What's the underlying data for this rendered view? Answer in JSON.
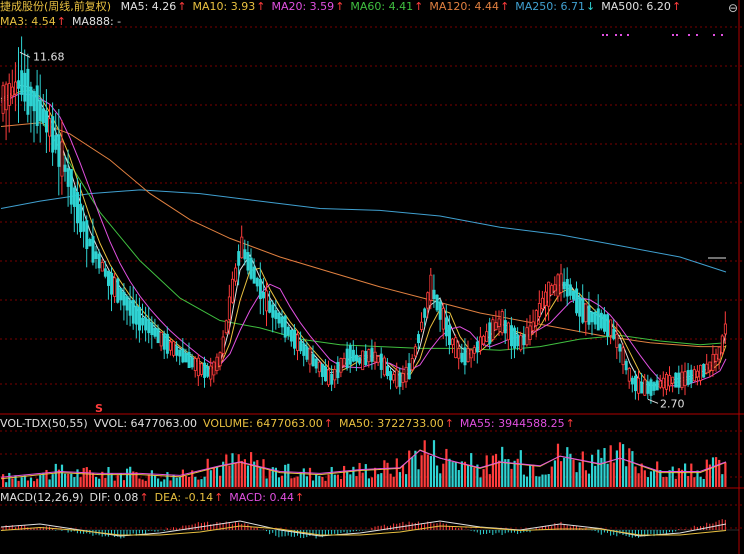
{
  "header": {
    "stock_title": "捷成股份(周线,前复权)",
    "ma_items": [
      {
        "text": "MA5: 4.26",
        "color": "#e0e0e0"
      },
      {
        "text": "MA10: 3.93",
        "color": "#e8c040"
      },
      {
        "text": "MA20: 3.59",
        "color": "#e050e0"
      },
      {
        "text": "MA60: 4.41",
        "color": "#40c040"
      },
      {
        "text": "MA120: 4.44",
        "color": "#e08040"
      },
      {
        "text": "MA250: 6.71",
        "color": "#40a0d0"
      },
      {
        "text": "MA500: 6.20",
        "color": "#e0e0e0"
      }
    ],
    "row2_items": [
      {
        "text": "MA3: 4.54",
        "color": "#e8c040"
      },
      {
        "text": "MA888: -",
        "color": "#e0e0e0"
      }
    ],
    "arrow_up": "↑",
    "arrow_down": "↓",
    "minimize_icon": "⊖"
  },
  "price_panel": {
    "high_label": "11.68",
    "low_label": "2.70",
    "marker": "S"
  },
  "volume_header": {
    "items": [
      {
        "text": "VOL-TDX(50,55)",
        "color": "#e0e0e0"
      },
      {
        "text": "VVOL: 6477063.00",
        "color": "#e0e0e0"
      },
      {
        "text": "VOLUME: 6477063.00",
        "color": "#e8c040"
      },
      {
        "text": "MA50: 3722733.00",
        "color": "#e8c040"
      },
      {
        "text": "MA55: 3944588.25",
        "color": "#e050e0"
      }
    ]
  },
  "macd_header": {
    "items": [
      {
        "text": "MACD(12,26,9)",
        "color": "#e0e0e0"
      },
      {
        "text": "DIF: 0.08",
        "color": "#e0e0e0"
      },
      {
        "text": "DEA: -0.14",
        "color": "#e8c040"
      },
      {
        "text": "MACD: 0.44",
        "color": "#e050e0"
      }
    ]
  },
  "colors": {
    "up": "#ff3c3c",
    "down": "#2fd3d3",
    "grid": "#7a0000",
    "ma5": "#e0e0e0",
    "ma10": "#e8c040",
    "ma20": "#e050e0",
    "ma60": "#40c040",
    "ma120": "#e08040",
    "ma250": "#40a0d0"
  },
  "chart_data": {
    "type": "candlestick",
    "price_range": [
      2.2,
      12.6
    ],
    "ma250_path": [
      [
        1,
        7.6
      ],
      [
        40,
        7.8
      ],
      [
        90,
        8.0
      ],
      [
        140,
        8.1
      ],
      [
        200,
        8.0
      ],
      [
        260,
        7.8
      ],
      [
        320,
        7.6
      ],
      [
        380,
        7.55
      ],
      [
        440,
        7.4
      ],
      [
        500,
        7.1
      ],
      [
        560,
        6.9
      ],
      [
        620,
        6.6
      ],
      [
        680,
        6.3
      ],
      [
        726,
        5.9
      ]
    ],
    "ma120_path": [
      [
        1,
        9.8
      ],
      [
        40,
        9.9
      ],
      [
        70,
        9.6
      ],
      [
        110,
        8.9
      ],
      [
        150,
        8.0
      ],
      [
        190,
        7.3
      ],
      [
        230,
        6.8
      ],
      [
        280,
        6.3
      ],
      [
        330,
        5.9
      ],
      [
        380,
        5.5
      ],
      [
        430,
        5.15
      ],
      [
        480,
        4.8
      ],
      [
        540,
        4.5
      ],
      [
        600,
        4.2
      ],
      [
        650,
        4.0
      ],
      [
        700,
        3.9
      ],
      [
        726,
        3.9
      ]
    ],
    "ma60_path": [
      [
        40,
        10.0
      ],
      [
        70,
        8.8
      ],
      [
        100,
        7.5
      ],
      [
        140,
        6.2
      ],
      [
        180,
        5.2
      ],
      [
        220,
        4.6
      ],
      [
        260,
        4.4
      ],
      [
        300,
        4.1
      ],
      [
        340,
        3.95
      ],
      [
        380,
        3.9
      ],
      [
        420,
        3.85
      ],
      [
        460,
        3.85
      ],
      [
        500,
        3.8
      ],
      [
        540,
        3.9
      ],
      [
        580,
        4.1
      ],
      [
        620,
        4.2
      ],
      [
        660,
        4.05
      ],
      [
        700,
        3.95
      ],
      [
        726,
        4.0
      ]
    ],
    "trend_path": [
      [
        1,
        10.5
      ],
      [
        10,
        10.7
      ],
      [
        20,
        11.0
      ],
      [
        30,
        10.6
      ],
      [
        40,
        10.2
      ],
      [
        50,
        9.7
      ],
      [
        60,
        9.0
      ],
      [
        70,
        8.2
      ],
      [
        80,
        7.3
      ],
      [
        90,
        6.6
      ],
      [
        100,
        6.1
      ],
      [
        110,
        5.6
      ],
      [
        120,
        5.3
      ],
      [
        130,
        4.9
      ],
      [
        140,
        4.6
      ],
      [
        150,
        4.4
      ],
      [
        160,
        4.1
      ],
      [
        170,
        3.9
      ],
      [
        180,
        3.7
      ],
      [
        190,
        3.5
      ],
      [
        200,
        3.3
      ],
      [
        210,
        3.2
      ],
      [
        220,
        3.6
      ],
      [
        230,
        5.2
      ],
      [
        240,
        6.6
      ],
      [
        250,
        6.0
      ],
      [
        260,
        5.4
      ],
      [
        270,
        4.9
      ],
      [
        280,
        4.6
      ],
      [
        290,
        4.2
      ],
      [
        300,
        3.9
      ],
      [
        310,
        3.6
      ],
      [
        320,
        3.3
      ],
      [
        330,
        3.0
      ],
      [
        340,
        3.4
      ],
      [
        350,
        3.7
      ],
      [
        360,
        3.5
      ],
      [
        370,
        3.7
      ],
      [
        380,
        3.5
      ],
      [
        390,
        3.1
      ],
      [
        400,
        3.0
      ],
      [
        410,
        3.3
      ],
      [
        420,
        4.4
      ],
      [
        430,
        5.5
      ],
      [
        440,
        4.8
      ],
      [
        450,
        4.1
      ],
      [
        460,
        3.6
      ],
      [
        470,
        3.7
      ],
      [
        480,
        4.0
      ],
      [
        490,
        4.3
      ],
      [
        500,
        4.6
      ],
      [
        510,
        4.2
      ],
      [
        520,
        4.0
      ],
      [
        530,
        4.3
      ],
      [
        540,
        5.0
      ],
      [
        550,
        5.4
      ],
      [
        560,
        5.6
      ],
      [
        570,
        5.4
      ],
      [
        580,
        4.9
      ],
      [
        590,
        4.7
      ],
      [
        600,
        4.6
      ],
      [
        610,
        4.4
      ],
      [
        620,
        3.8
      ],
      [
        630,
        3.0
      ],
      [
        640,
        2.8
      ],
      [
        650,
        2.8
      ],
      [
        660,
        2.9
      ],
      [
        670,
        3.0
      ],
      [
        680,
        3.0
      ],
      [
        690,
        3.1
      ],
      [
        700,
        3.2
      ],
      [
        710,
        3.4
      ],
      [
        720,
        3.8
      ],
      [
        726,
        4.6
      ]
    ],
    "volume_envelope": [
      [
        1,
        0.2
      ],
      [
        20,
        0.25
      ],
      [
        60,
        0.35
      ],
      [
        100,
        0.3
      ],
      [
        140,
        0.3
      ],
      [
        180,
        0.25
      ],
      [
        220,
        0.5
      ],
      [
        240,
        0.6
      ],
      [
        280,
        0.35
      ],
      [
        320,
        0.3
      ],
      [
        360,
        0.4
      ],
      [
        400,
        0.45
      ],
      [
        420,
        0.9
      ],
      [
        440,
        0.7
      ],
      [
        480,
        0.45
      ],
      [
        500,
        0.6
      ],
      [
        540,
        0.5
      ],
      [
        560,
        0.75
      ],
      [
        600,
        0.55
      ],
      [
        620,
        0.7
      ],
      [
        660,
        0.35
      ],
      [
        700,
        0.35
      ],
      [
        726,
        0.6
      ]
    ],
    "macd_dif": [
      [
        1,
        0.5
      ],
      [
        40,
        0.6
      ],
      [
        80,
        0.4
      ],
      [
        120,
        0.2
      ],
      [
        160,
        0.3
      ],
      [
        200,
        0.5
      ],
      [
        240,
        0.7
      ],
      [
        280,
        0.4
      ],
      [
        320,
        0.2
      ],
      [
        360,
        0.3
      ],
      [
        400,
        0.5
      ],
      [
        440,
        0.7
      ],
      [
        480,
        0.5
      ],
      [
        520,
        0.4
      ],
      [
        560,
        0.6
      ],
      [
        600,
        0.45
      ],
      [
        640,
        0.2
      ],
      [
        680,
        0.3
      ],
      [
        726,
        0.6
      ]
    ],
    "macd_dea": [
      [
        1,
        0.45
      ],
      [
        40,
        0.55
      ],
      [
        80,
        0.45
      ],
      [
        120,
        0.3
      ],
      [
        160,
        0.3
      ],
      [
        200,
        0.4
      ],
      [
        240,
        0.6
      ],
      [
        280,
        0.5
      ],
      [
        320,
        0.3
      ],
      [
        360,
        0.3
      ],
      [
        400,
        0.4
      ],
      [
        440,
        0.6
      ],
      [
        480,
        0.55
      ],
      [
        520,
        0.45
      ],
      [
        560,
        0.5
      ],
      [
        600,
        0.5
      ],
      [
        640,
        0.3
      ],
      [
        680,
        0.3
      ],
      [
        726,
        0.45
      ]
    ],
    "high": 11.68,
    "low": 2.7
  }
}
